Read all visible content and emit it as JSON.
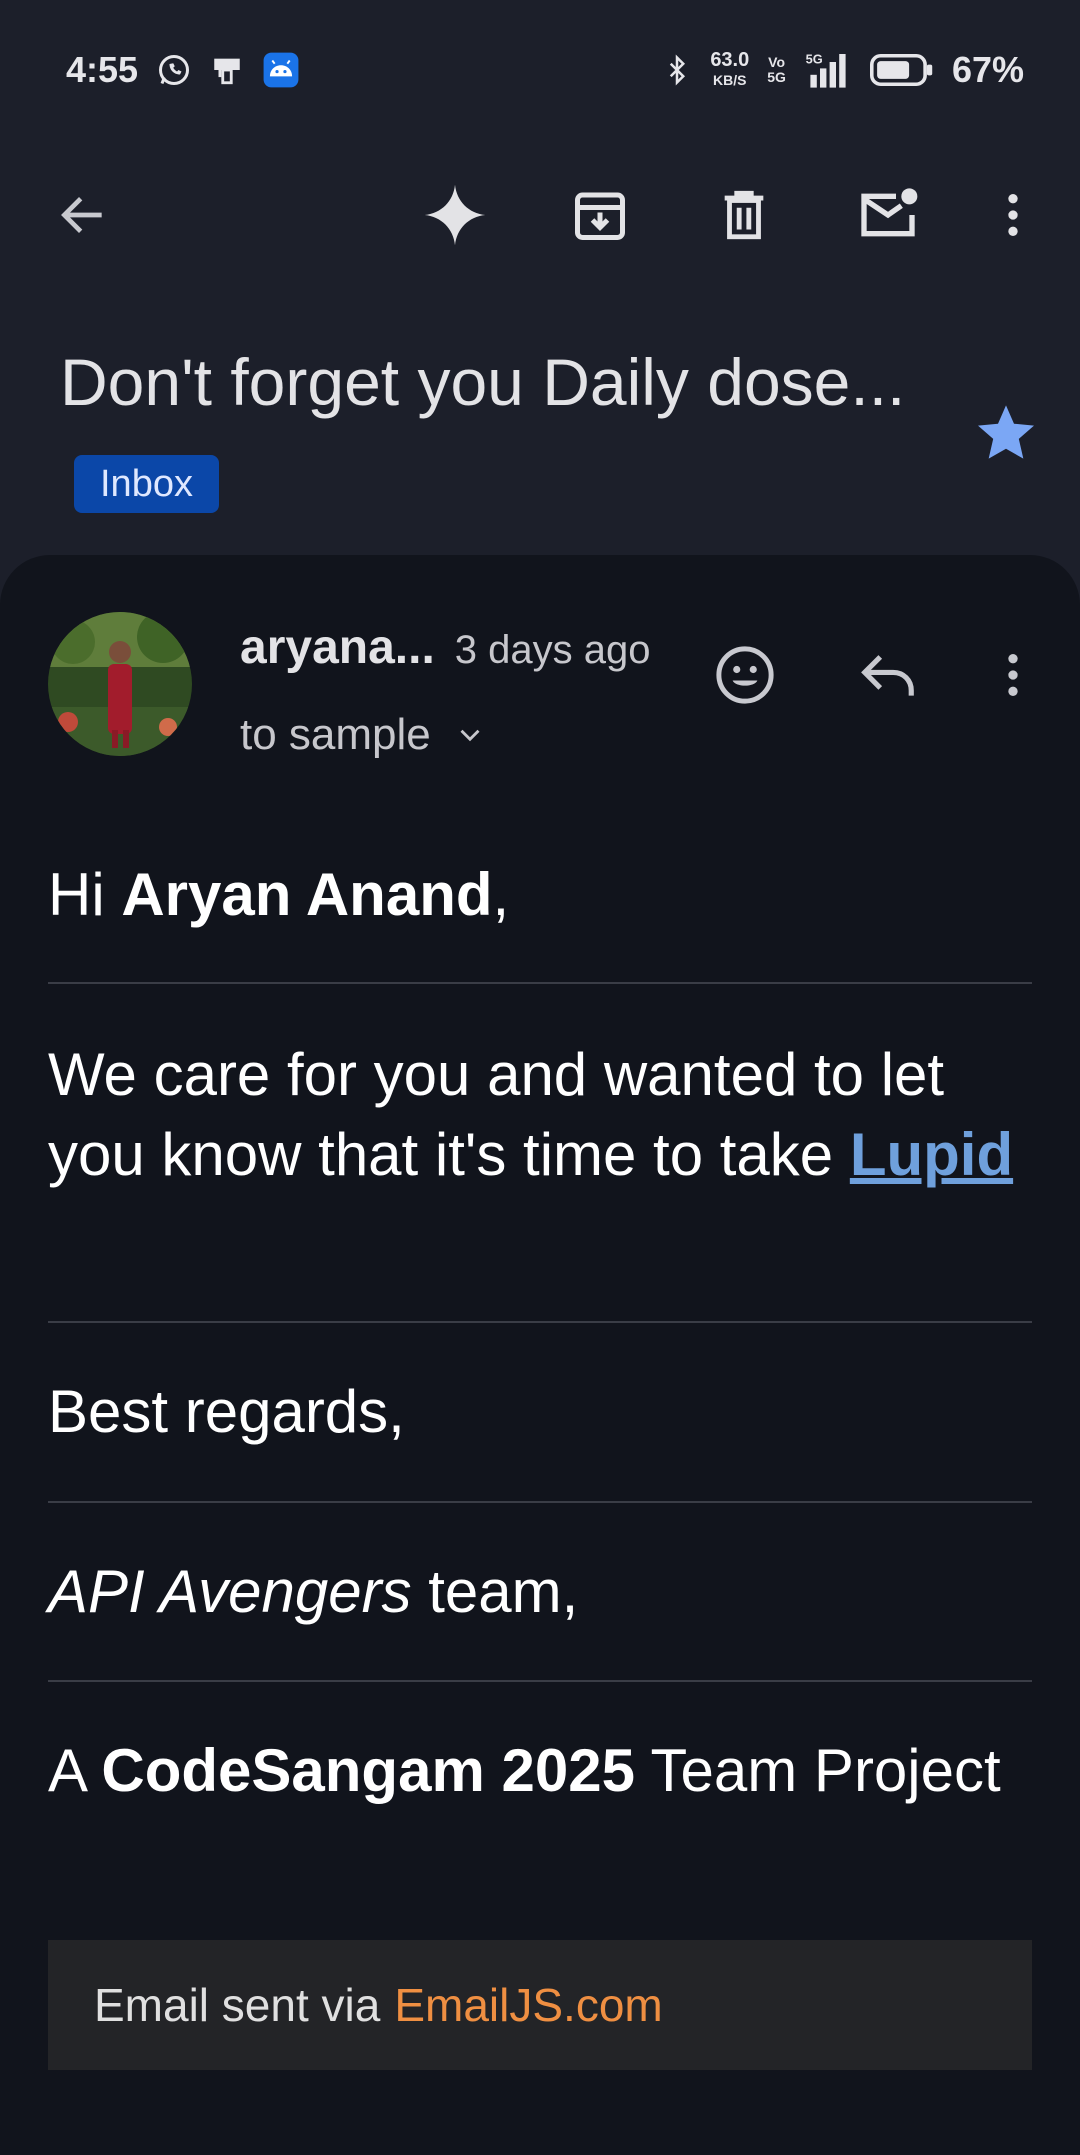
{
  "status_bar": {
    "time": "4:55",
    "net_speed": "63.0",
    "net_unit": "KB/S",
    "volte_top": "Vo",
    "volte_bottom": "5G",
    "network": "5G",
    "battery_pct": "67%",
    "icons": [
      "whatsapp-icon",
      "device-icon",
      "android-icon",
      "bluetooth-icon",
      "signal-icon",
      "battery-icon"
    ]
  },
  "toolbar": {
    "icons": [
      "back-arrow-icon",
      "gemini-sparkle-icon",
      "archive-icon",
      "delete-icon",
      "mark-unread-icon",
      "more-vert-icon"
    ]
  },
  "email": {
    "subject": "Don't forget you Daily dose...",
    "label": "Inbox",
    "starred": true,
    "sender": "aryana...",
    "time": "3 days ago",
    "recipient": "to sample",
    "greeting_prefix": "Hi ",
    "greeting_name": "Aryan Anand",
    "greeting_suffix": ",",
    "body_text": "We care for you and wanted to let you know that it's time to take ",
    "medicine_link": "Lupid",
    "regards": "Best regards,",
    "team_italic": "API Avengers",
    "team_suffix": " team,",
    "project_prefix": "A ",
    "project_bold": "CodeSangam 2025",
    "project_suffix": " Team Project",
    "footer_text": "Email sent via",
    "footer_link": "EmailJS.com"
  },
  "colors": {
    "background": "#1c1f2a",
    "card": "#11141c",
    "chip": "#0b47a8",
    "star": "#7ba7f5",
    "link": "#6fa0dc",
    "footer_link": "#ef8f42"
  }
}
